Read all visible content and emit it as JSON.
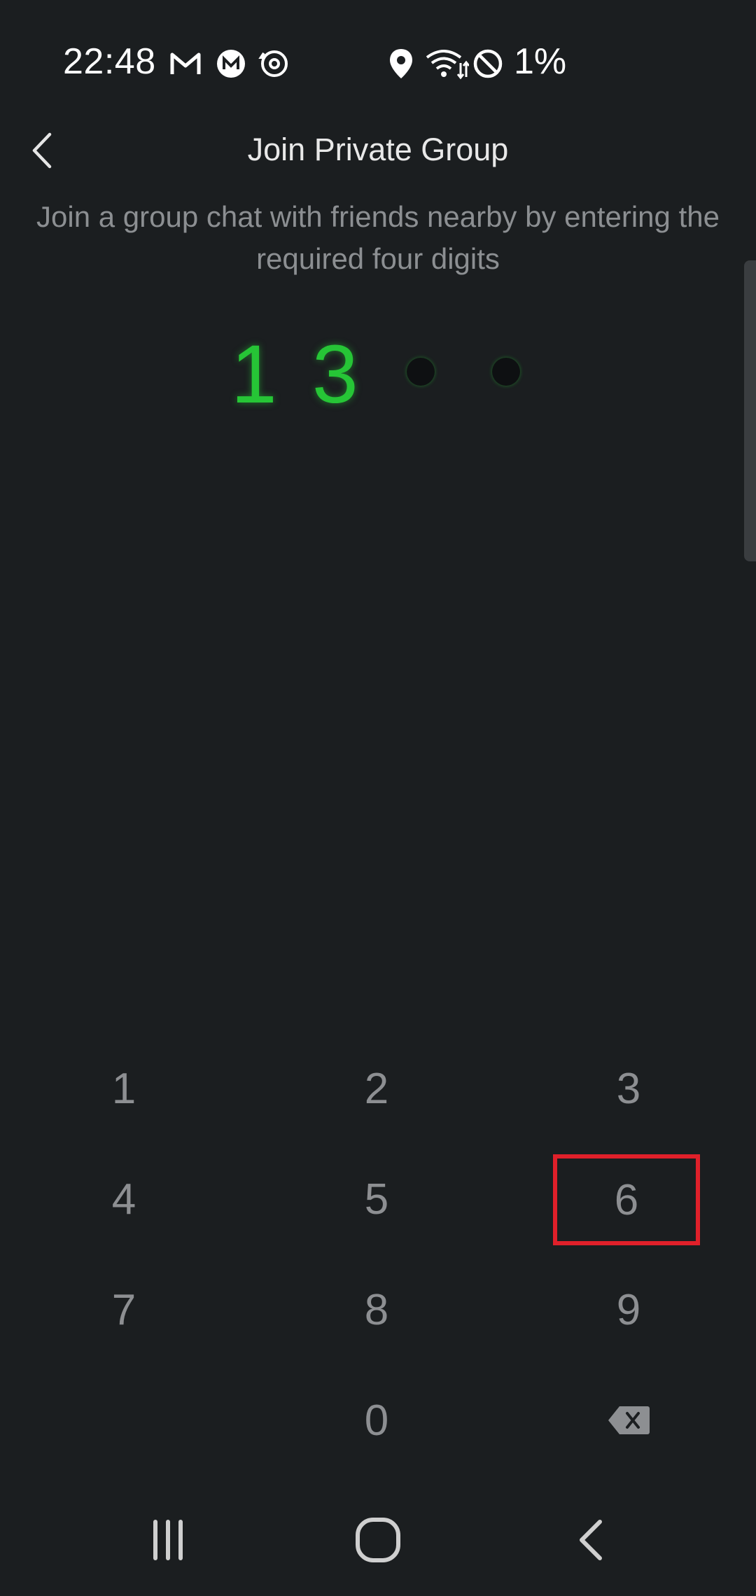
{
  "status_bar": {
    "time": "22:48",
    "battery": "1%",
    "icons": [
      "gmail-icon",
      "m-app-icon",
      "sync-icon",
      "location-icon",
      "wifi-icon",
      "do-not-disturb-icon"
    ]
  },
  "header": {
    "title": "Join Private Group",
    "subtitle": "Join a group chat with friends nearby by entering the required four digits"
  },
  "pin": {
    "entered": [
      "1",
      "3"
    ],
    "remaining_slots": 2,
    "accent_color": "#26c536"
  },
  "keypad": {
    "k1": "1",
    "k2": "2",
    "k3": "3",
    "k4": "4",
    "k5": "5",
    "k6": "6",
    "k7": "7",
    "k8": "8",
    "k9": "9",
    "k0": "0",
    "delete_icon": "backspace-icon",
    "highlighted_key": "6",
    "highlight_color": "#e0202a"
  },
  "nav": {
    "recents_icon": "recents-icon",
    "home_icon": "home-icon",
    "back_icon": "back-icon"
  }
}
